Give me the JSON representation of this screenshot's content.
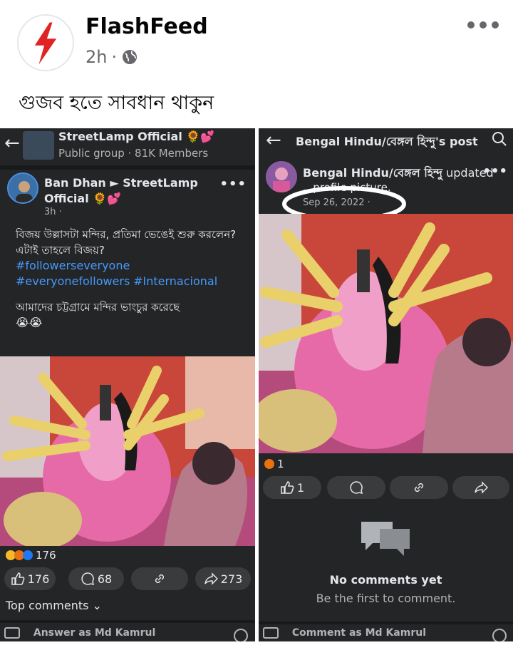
{
  "post": {
    "page_name": "FlashFeed",
    "time": "2h",
    "separator": "·",
    "caption": "গুজব হতে সাবধান থাকুন"
  },
  "left_shot": {
    "group_name": "StreetLamp Official 🌻💕",
    "group_meta": "Public group · 81K Members",
    "author_line1": "Ban Dhan ► StreetLamp",
    "author_line2": "Official 🌻💕",
    "time": "3h ·",
    "body_line1": "বিজয় উল্লাসটা মন্দির, প্রতিমা ভেঙেই শুরু করলেন?",
    "body_line2": "এটাই তাহলে বিজয়?",
    "hashtag1": "#followerseveryone",
    "hashtag2": "#everyonefollowers",
    "hashtag3": "#Internacional",
    "body_line3": "আমাদের চট্টগ্রামে মন্দির ভাংচুর করেছে",
    "body_emoji": "😭😭",
    "reaction_count": "176",
    "like_count": "176",
    "comment_count": "68",
    "share_count": "273",
    "top_comments": "Top comments",
    "comment_placeholder": "Answer as Md Kamrul"
  },
  "right_shot": {
    "title": "Bengal Hindu/বেঙ্গল হিন্দু's post",
    "author": "Bengal Hindu/বেঙ্গল হিন্দু",
    "updated": " updated",
    "sub": "...profile picture.",
    "date": "Sep 26, 2022 ·",
    "reaction_count": "1",
    "like_count": "1",
    "no_comments_title": "No comments yet",
    "no_comments_sub": "Be the first to comment.",
    "comment_placeholder": "Comment as Md Kamrul"
  },
  "colors": {
    "brand_red": "#e02424",
    "dark_bg": "#242526",
    "link_blue": "#4599ff"
  },
  "icons": [
    "flash-logo-icon",
    "globe-icon",
    "more-icon",
    "back-arrow-icon",
    "search-icon",
    "like-icon",
    "comment-icon",
    "link-icon",
    "share-icon",
    "chat-bubbles-icon",
    "photo-icon",
    "sticker-icon",
    "gif-icon",
    "emoji-icon"
  ]
}
